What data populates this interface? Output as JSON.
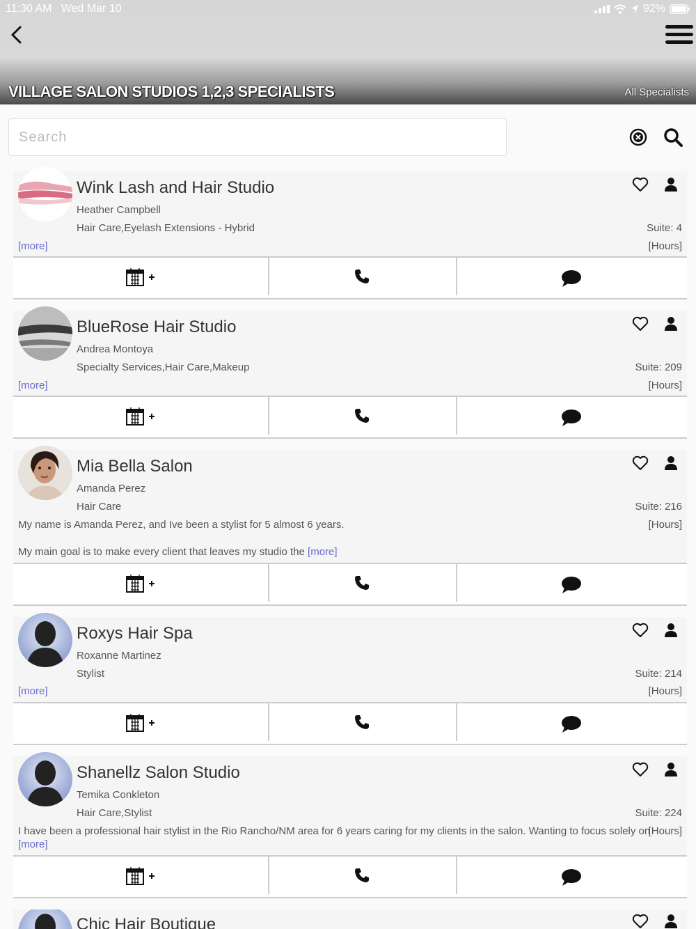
{
  "status_bar": {
    "time": "11:30 AM",
    "date": "Wed Mar 10",
    "battery": "92%"
  },
  "header": {
    "title": "VILLAGE SALON STUDIOS 1,2,3 SPECIALISTS",
    "all_specialists_label": "All Specialists"
  },
  "search": {
    "placeholder": "Search"
  },
  "icons": {
    "back": "back-chevron-icon",
    "menu": "hamburger-menu-icon",
    "clear": "clear-search-icon",
    "search": "magnifier-icon",
    "favorite": "heart-icon",
    "profile": "person-icon",
    "calendar": "calendar-add-icon",
    "phone": "phone-icon",
    "message": "chat-bubble-icon"
  },
  "listings": [
    {
      "name": "Wink Lash and Hair Studio",
      "owner": "Heather Campbell",
      "services": "Hair Care,Eyelash Extensions - Hybrid",
      "suite": "Suite: 4",
      "hours": "[Hours]",
      "more": "[more]",
      "description": ""
    },
    {
      "name": "BlueRose Hair Studio",
      "owner": "Andrea Montoya",
      "services": "Specialty Services,Hair Care,Makeup",
      "suite": "Suite: 209",
      "hours": "[Hours]",
      "more": "[more]",
      "description": ""
    },
    {
      "name": "Mia Bella Salon",
      "owner": "Amanda Perez",
      "services": "Hair Care",
      "suite": "Suite: 216",
      "hours": "[Hours]",
      "more": "[more]",
      "description": "My name is Amanda Perez, and Ive been a stylist for 5 almost 6 years.",
      "description2": "My main goal is to make every client that leaves my studio the"
    },
    {
      "name": "Roxys Hair Spa",
      "owner": "Roxanne Martinez",
      "services": "Stylist",
      "suite": "Suite: 214",
      "hours": "[Hours]",
      "more": "[more]",
      "description": ""
    },
    {
      "name": "Shanellz Salon Studio",
      "owner": "Temika Conkleton",
      "services": "Hair Care,Stylist",
      "suite": "Suite: 224",
      "hours": "[Hours]",
      "more": "[more]",
      "description": "I have been a professional hair stylist in the Rio Rancho/NM area for 6 years caring for my clients in the salon. Wanting to focus solely on"
    },
    {
      "name": "Chic Hair Boutique"
    }
  ]
}
